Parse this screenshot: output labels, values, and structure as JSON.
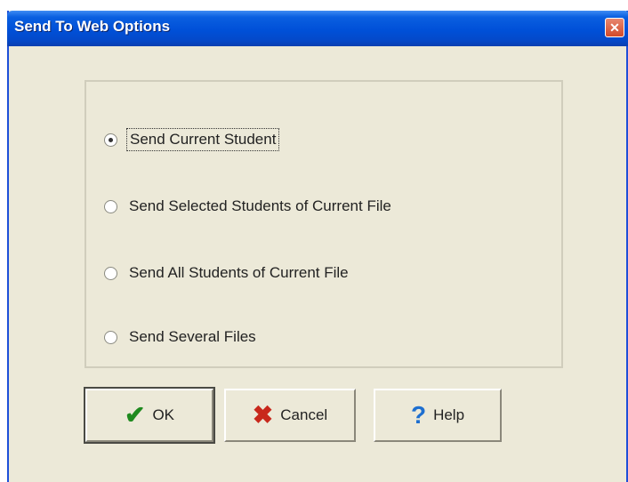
{
  "window": {
    "title": "Send To Web Options",
    "close_glyph": "✕"
  },
  "options": [
    {
      "label": "Send Current Student",
      "selected": true
    },
    {
      "label": "Send Selected Students of Current File",
      "selected": false
    },
    {
      "label": "Send All Students of Current File",
      "selected": false
    },
    {
      "label": "Send Several Files",
      "selected": false
    }
  ],
  "buttons": {
    "ok_label": "OK",
    "cancel_label": "Cancel",
    "help_label": "Help"
  },
  "icons": {
    "ok": "checkmark-icon",
    "cancel": "x-icon",
    "help": "question-mark-icon"
  },
  "colors": {
    "titlebar": "#0050d8",
    "dialog_bg": "#ece9d8",
    "ok_icon": "#1f8a1f",
    "cancel_icon": "#c8281c",
    "help_icon": "#1e6fd0"
  }
}
